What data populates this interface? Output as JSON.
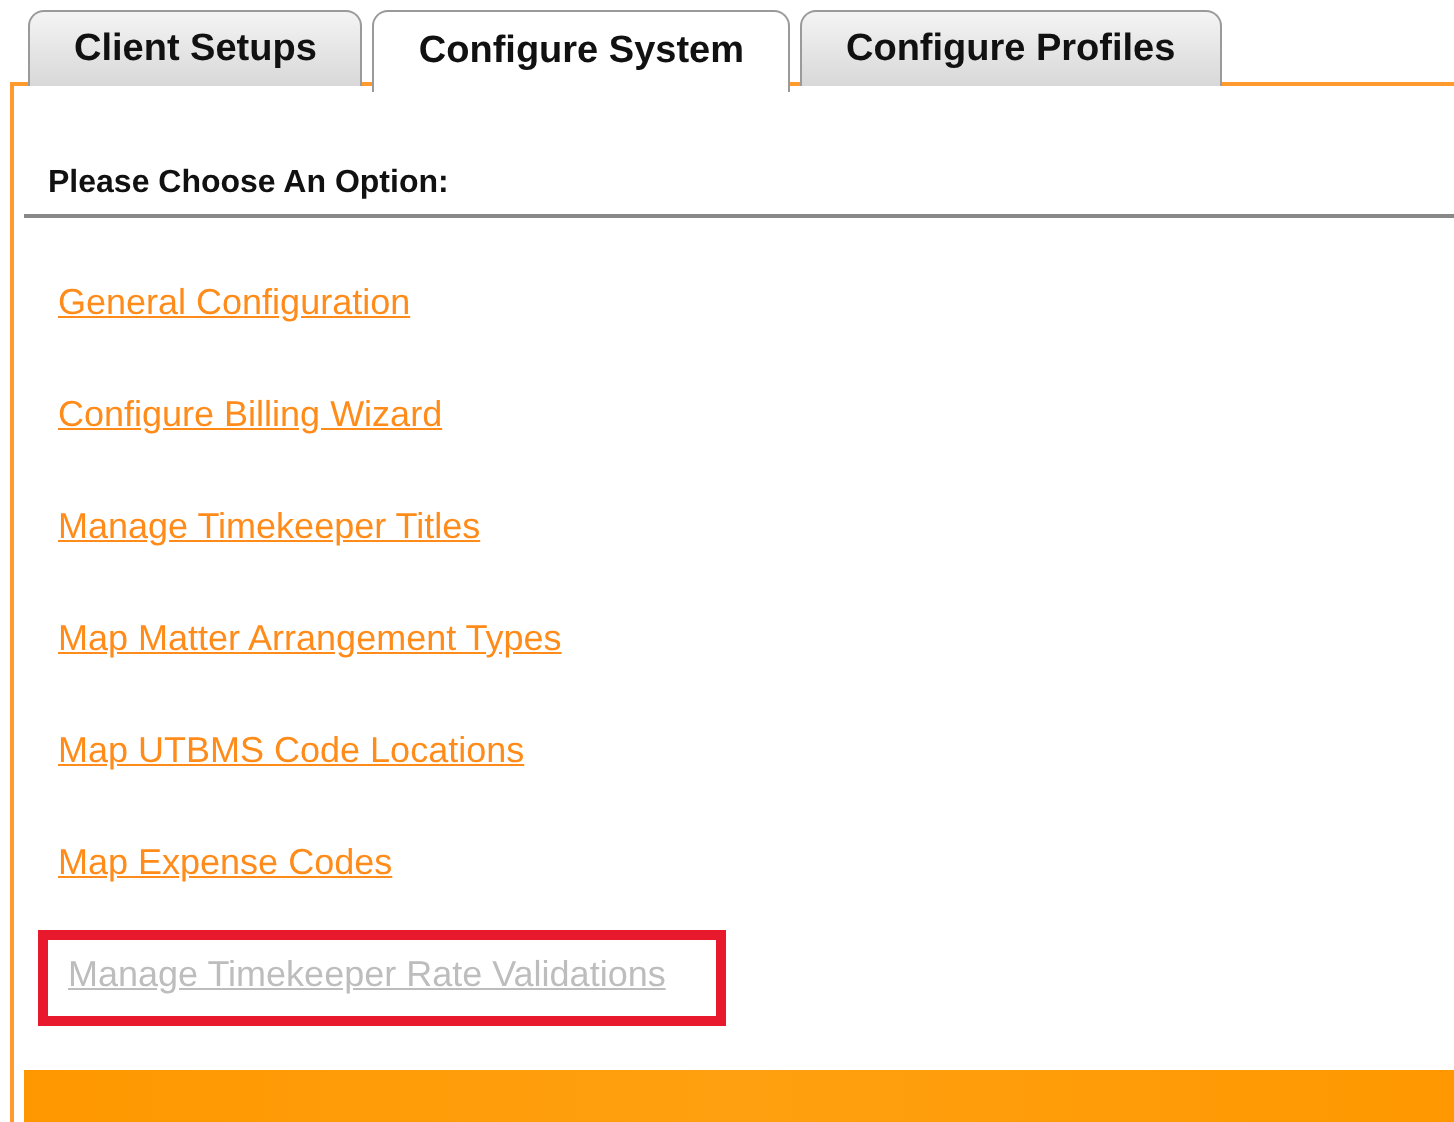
{
  "tabs": [
    {
      "label": "Client Setups",
      "selected": false
    },
    {
      "label": "Configure System",
      "selected": true
    },
    {
      "label": "Configure Profiles",
      "selected": false
    }
  ],
  "heading": "Please Choose An Option:",
  "options": [
    {
      "label": "General Configuration",
      "disabled": false,
      "highlighted": false
    },
    {
      "label": "Configure Billing Wizard",
      "disabled": false,
      "highlighted": false
    },
    {
      "label": "Manage Timekeeper Titles",
      "disabled": false,
      "highlighted": false
    },
    {
      "label": "Map Matter Arrangement Types",
      "disabled": false,
      "highlighted": false
    },
    {
      "label": "Map UTBMS Code Locations",
      "disabled": false,
      "highlighted": false
    },
    {
      "label": "Map Expense Codes",
      "disabled": false,
      "highlighted": false
    },
    {
      "label": "Manage Timekeeper Rate Validations",
      "disabled": true,
      "highlighted": true
    }
  ]
}
